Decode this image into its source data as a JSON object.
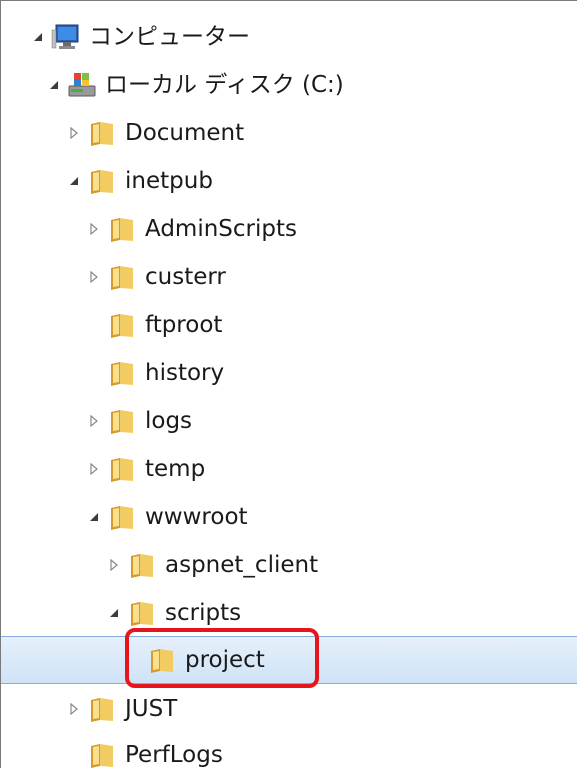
{
  "tree": {
    "items": [
      {
        "label": "コンピューター",
        "icon": "computer-icon",
        "state": "expanded"
      },
      {
        "label": "ローカル ディスク (C:)",
        "icon": "local-disk-icon",
        "state": "expanded"
      },
      {
        "label": "Document",
        "icon": "folder-icon",
        "state": "collapsed"
      },
      {
        "label": "inetpub",
        "icon": "folder-icon",
        "state": "expanded"
      },
      {
        "label": "AdminScripts",
        "icon": "folder-icon",
        "state": "collapsed"
      },
      {
        "label": "custerr",
        "icon": "folder-icon",
        "state": "collapsed"
      },
      {
        "label": "ftproot",
        "icon": "folder-icon",
        "state": "none"
      },
      {
        "label": "history",
        "icon": "folder-icon",
        "state": "none"
      },
      {
        "label": "logs",
        "icon": "folder-icon",
        "state": "collapsed"
      },
      {
        "label": "temp",
        "icon": "folder-icon",
        "state": "collapsed"
      },
      {
        "label": "wwwroot",
        "icon": "folder-icon",
        "state": "expanded"
      },
      {
        "label": "aspnet_client",
        "icon": "folder-icon",
        "state": "collapsed"
      },
      {
        "label": "scripts",
        "icon": "folder-icon",
        "state": "expanded"
      },
      {
        "label": "project",
        "icon": "folder-icon",
        "state": "none",
        "selected": true
      },
      {
        "label": "JUST",
        "icon": "folder-icon",
        "state": "collapsed"
      },
      {
        "label": "PerfLogs",
        "icon": "folder-icon",
        "state": "none"
      }
    ]
  },
  "colors": {
    "selection_bg": "#cfe3f8",
    "selection_border": "#84acdd",
    "highlight": "#e8141b",
    "folder": "#e8b94a"
  }
}
